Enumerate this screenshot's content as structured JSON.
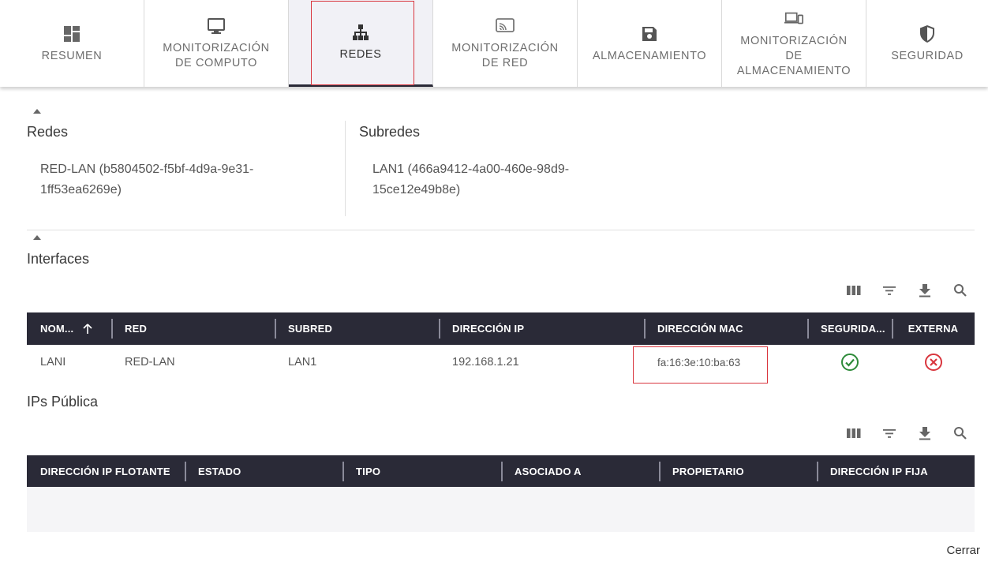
{
  "tabs": [
    {
      "label": "RESUMEN",
      "icon": "dashboard-icon"
    },
    {
      "label": "MONITORIZACIÓN\nDE COMPUTO",
      "icon": "monitor-icon"
    },
    {
      "label": "REDES",
      "icon": "network-icon",
      "active": true
    },
    {
      "label": "MONITORIZACIÓN\nDE RED",
      "icon": "cast-icon"
    },
    {
      "label": "ALMACENAMIENTO",
      "icon": "floppy-disk-icon"
    },
    {
      "label": "MONITORIZACIÓN\nDE\nALMACENAMIENTO",
      "icon": "devices-icon"
    },
    {
      "label": "SEGURIDAD",
      "icon": "shield-icon"
    }
  ],
  "networks": {
    "title": "Redes",
    "value": "RED-LAN (b5804502-f5bf-4d9a-9e31-\n1ff53ea6269e)"
  },
  "subnets": {
    "title": "Subredes",
    "value": "LAN1 (466a9412-4a00-460e-98d9-\n15ce12e49b8e)"
  },
  "interfaces": {
    "title": "Interfaces",
    "columns": [
      "NOM...",
      "RED",
      "SUBRED",
      "DIRECCIÓN IP",
      "DIRECCIÓN MAC",
      "SEGURIDA...",
      "EXTERNA"
    ],
    "sort_icon": "arrow-up-icon",
    "rows": [
      {
        "name": "LANI",
        "network": "RED-LAN",
        "subnet": "LAN1",
        "ip": "192.168.1.21",
        "mac": "fa:16:3e:10:ba:63",
        "security": "check-circle-icon",
        "external": "cancel-circle-icon"
      }
    ]
  },
  "public_ips": {
    "title": "IPs Pública",
    "columns": [
      "DIRECCIÓN IP FLOTANTE",
      "ESTADO",
      "TIPO",
      "ASOCIADO A",
      "PROPIETARIO",
      "DIRECCIÓN IP FIJA"
    ],
    "rows": []
  },
  "toolbar_icons": [
    "columns-icon",
    "filter-icon",
    "download-icon",
    "search-icon"
  ],
  "close_label": "Cerrar",
  "colors": {
    "header_bg": "#2a2a37",
    "active_tab_bg": "#f1f1f6",
    "highlight": "#d9363e",
    "ok": "#2e8b3a",
    "error": "#d9363e"
  }
}
